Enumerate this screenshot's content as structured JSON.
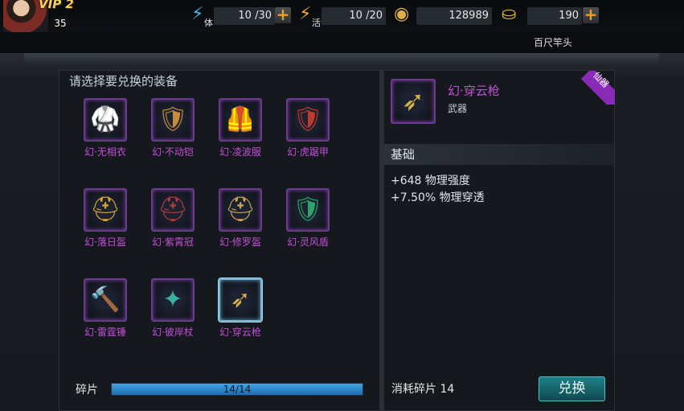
{
  "header": {
    "vip_label": "VIP 2",
    "level": "35",
    "stamina_sub": "体",
    "stamina": "10 /30",
    "vitality_sub": "活",
    "vitality": "10 /20",
    "coins": "128989",
    "gold": "190",
    "plus": "+",
    "location": "百尺竿头"
  },
  "left_panel": {
    "title": "请选择要兑换的装备",
    "items": [
      {
        "name": "幻·无相衣",
        "icon": "robe-armor-icon",
        "glyph": "🥋",
        "color": "#3aa8c4"
      },
      {
        "name": "幻·不动铠",
        "icon": "plate-armor-icon",
        "glyph": "🛡",
        "color": "#c98a3a"
      },
      {
        "name": "幻·凌波服",
        "icon": "silver-armor-icon",
        "glyph": "🦺",
        "color": "#9ca7c4"
      },
      {
        "name": "幻·虎踞甲",
        "icon": "red-armor-icon",
        "glyph": "🛡",
        "color": "#c0392b"
      },
      {
        "name": "幻·落日盔",
        "icon": "golden-helmet-icon",
        "glyph": "⛑",
        "color": "#d6a62e"
      },
      {
        "name": "幻·紫霄冠",
        "icon": "crimson-helmet-icon",
        "glyph": "⛑",
        "color": "#b33a3a"
      },
      {
        "name": "幻·修罗盔",
        "icon": "horned-helmet-icon",
        "glyph": "⛑",
        "color": "#c8a25a"
      },
      {
        "name": "幻·灵风盾",
        "icon": "green-shield-icon",
        "glyph": "🛡",
        "color": "#2ea36a"
      },
      {
        "name": "幻·雷霆锤",
        "icon": "hammer-icon",
        "glyph": "🔨",
        "color": "#d8c36a"
      },
      {
        "name": "幻·彼岸杖",
        "icon": "staff-icon",
        "glyph": "✦",
        "color": "#3ab0a0"
      },
      {
        "name": "幻·穿云枪",
        "icon": "spear-icon",
        "glyph": "➶",
        "color": "#d6b04a"
      }
    ],
    "fragment_label": "碎片",
    "fragment_progress": "14/14",
    "fragment_fraction": 1.0
  },
  "detail": {
    "name": "幻·穿云枪",
    "type": "武器",
    "rarity": "仙器",
    "section": "基础",
    "stats": [
      "+648 物理强度",
      "+7.50% 物理穿透"
    ],
    "cost": "消耗碎片 14",
    "button": "兑换"
  }
}
